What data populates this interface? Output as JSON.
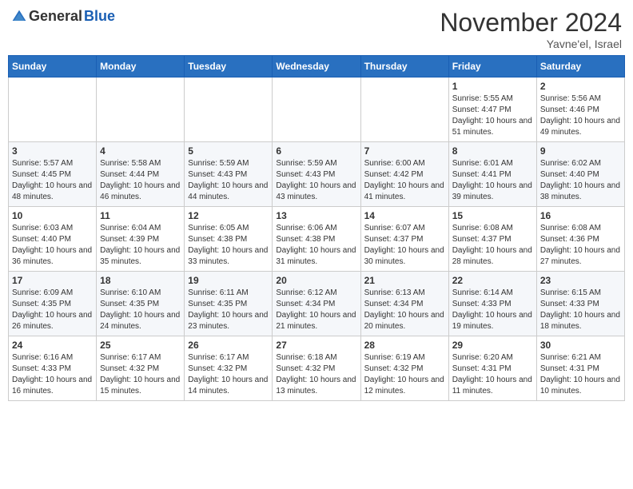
{
  "header": {
    "logo_general": "General",
    "logo_blue": "Blue",
    "month_title": "November 2024",
    "location": "Yavne'el, Israel"
  },
  "weekdays": [
    "Sunday",
    "Monday",
    "Tuesday",
    "Wednesday",
    "Thursday",
    "Friday",
    "Saturday"
  ],
  "weeks": [
    [
      {
        "day": null,
        "info": null
      },
      {
        "day": null,
        "info": null
      },
      {
        "day": null,
        "info": null
      },
      {
        "day": null,
        "info": null
      },
      {
        "day": null,
        "info": null
      },
      {
        "day": "1",
        "info": "Sunrise: 5:55 AM\nSunset: 4:47 PM\nDaylight: 10 hours and 51 minutes."
      },
      {
        "day": "2",
        "info": "Sunrise: 5:56 AM\nSunset: 4:46 PM\nDaylight: 10 hours and 49 minutes."
      }
    ],
    [
      {
        "day": "3",
        "info": "Sunrise: 5:57 AM\nSunset: 4:45 PM\nDaylight: 10 hours and 48 minutes."
      },
      {
        "day": "4",
        "info": "Sunrise: 5:58 AM\nSunset: 4:44 PM\nDaylight: 10 hours and 46 minutes."
      },
      {
        "day": "5",
        "info": "Sunrise: 5:59 AM\nSunset: 4:43 PM\nDaylight: 10 hours and 44 minutes."
      },
      {
        "day": "6",
        "info": "Sunrise: 5:59 AM\nSunset: 4:43 PM\nDaylight: 10 hours and 43 minutes."
      },
      {
        "day": "7",
        "info": "Sunrise: 6:00 AM\nSunset: 4:42 PM\nDaylight: 10 hours and 41 minutes."
      },
      {
        "day": "8",
        "info": "Sunrise: 6:01 AM\nSunset: 4:41 PM\nDaylight: 10 hours and 39 minutes."
      },
      {
        "day": "9",
        "info": "Sunrise: 6:02 AM\nSunset: 4:40 PM\nDaylight: 10 hours and 38 minutes."
      }
    ],
    [
      {
        "day": "10",
        "info": "Sunrise: 6:03 AM\nSunset: 4:40 PM\nDaylight: 10 hours and 36 minutes."
      },
      {
        "day": "11",
        "info": "Sunrise: 6:04 AM\nSunset: 4:39 PM\nDaylight: 10 hours and 35 minutes."
      },
      {
        "day": "12",
        "info": "Sunrise: 6:05 AM\nSunset: 4:38 PM\nDaylight: 10 hours and 33 minutes."
      },
      {
        "day": "13",
        "info": "Sunrise: 6:06 AM\nSunset: 4:38 PM\nDaylight: 10 hours and 31 minutes."
      },
      {
        "day": "14",
        "info": "Sunrise: 6:07 AM\nSunset: 4:37 PM\nDaylight: 10 hours and 30 minutes."
      },
      {
        "day": "15",
        "info": "Sunrise: 6:08 AM\nSunset: 4:37 PM\nDaylight: 10 hours and 28 minutes."
      },
      {
        "day": "16",
        "info": "Sunrise: 6:08 AM\nSunset: 4:36 PM\nDaylight: 10 hours and 27 minutes."
      }
    ],
    [
      {
        "day": "17",
        "info": "Sunrise: 6:09 AM\nSunset: 4:35 PM\nDaylight: 10 hours and 26 minutes."
      },
      {
        "day": "18",
        "info": "Sunrise: 6:10 AM\nSunset: 4:35 PM\nDaylight: 10 hours and 24 minutes."
      },
      {
        "day": "19",
        "info": "Sunrise: 6:11 AM\nSunset: 4:35 PM\nDaylight: 10 hours and 23 minutes."
      },
      {
        "day": "20",
        "info": "Sunrise: 6:12 AM\nSunset: 4:34 PM\nDaylight: 10 hours and 21 minutes."
      },
      {
        "day": "21",
        "info": "Sunrise: 6:13 AM\nSunset: 4:34 PM\nDaylight: 10 hours and 20 minutes."
      },
      {
        "day": "22",
        "info": "Sunrise: 6:14 AM\nSunset: 4:33 PM\nDaylight: 10 hours and 19 minutes."
      },
      {
        "day": "23",
        "info": "Sunrise: 6:15 AM\nSunset: 4:33 PM\nDaylight: 10 hours and 18 minutes."
      }
    ],
    [
      {
        "day": "24",
        "info": "Sunrise: 6:16 AM\nSunset: 4:33 PM\nDaylight: 10 hours and 16 minutes."
      },
      {
        "day": "25",
        "info": "Sunrise: 6:17 AM\nSunset: 4:32 PM\nDaylight: 10 hours and 15 minutes."
      },
      {
        "day": "26",
        "info": "Sunrise: 6:17 AM\nSunset: 4:32 PM\nDaylight: 10 hours and 14 minutes."
      },
      {
        "day": "27",
        "info": "Sunrise: 6:18 AM\nSunset: 4:32 PM\nDaylight: 10 hours and 13 minutes."
      },
      {
        "day": "28",
        "info": "Sunrise: 6:19 AM\nSunset: 4:32 PM\nDaylight: 10 hours and 12 minutes."
      },
      {
        "day": "29",
        "info": "Sunrise: 6:20 AM\nSunset: 4:31 PM\nDaylight: 10 hours and 11 minutes."
      },
      {
        "day": "30",
        "info": "Sunrise: 6:21 AM\nSunset: 4:31 PM\nDaylight: 10 hours and 10 minutes."
      }
    ]
  ]
}
